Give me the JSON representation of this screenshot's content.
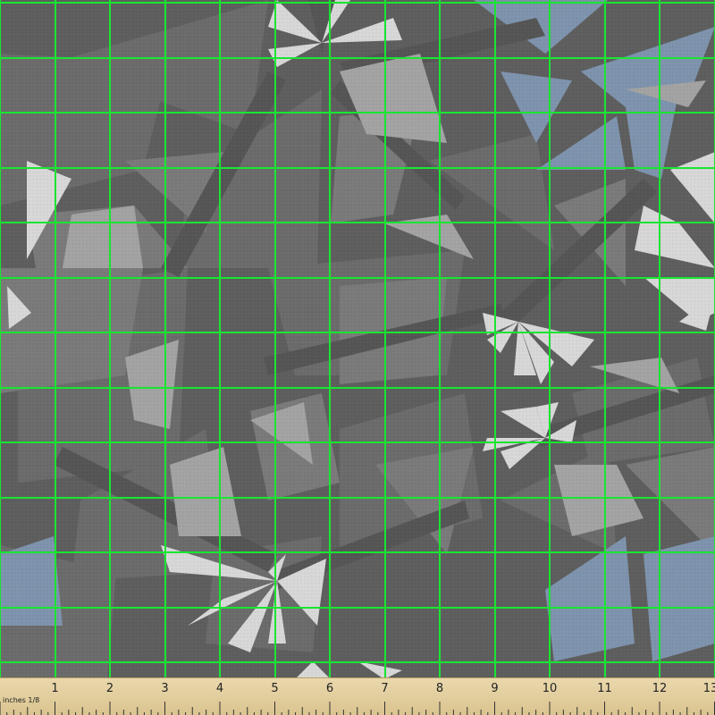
{
  "image": {
    "description_label": "Geometric fabric swatch",
    "background_color": "#5e5e5e",
    "grid_color": "#19e632",
    "accent_blue": "#7e93ad",
    "light_gray": "#d9d9d9",
    "mid_gray": "#8f8f8f"
  },
  "ruler": {
    "unit_label": "inches 1/8",
    "numbers": [
      "1",
      "2",
      "3",
      "4",
      "5",
      "6",
      "7",
      "8",
      "9",
      "10",
      "11",
      "12",
      "13"
    ]
  }
}
